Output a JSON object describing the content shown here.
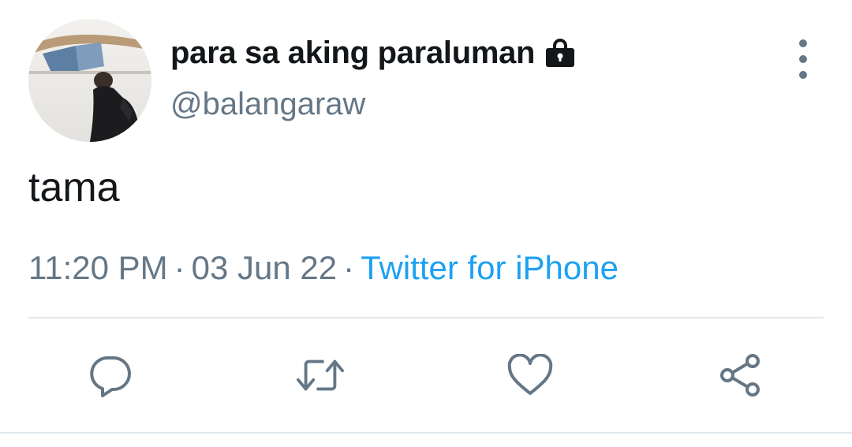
{
  "tweet": {
    "author": {
      "display_name": "para sa aking paraluman",
      "handle": "@balangaraw",
      "protected_icon": "lock-icon",
      "avatar_icon": "avatar"
    },
    "text": "tama",
    "meta": {
      "time": "11:20 PM",
      "separator": "·",
      "date": "03 Jun 22",
      "source": "Twitter for iPhone"
    },
    "actions": {
      "reply_icon": "reply-icon",
      "retweet_icon": "retweet-icon",
      "like_icon": "heart-icon",
      "share_icon": "share-icon"
    },
    "more_icon": "more-vertical-icon"
  },
  "colors": {
    "text_primary": "#14171a",
    "text_secondary": "#657786",
    "link": "#1da1f2",
    "divider": "#e1e8ed"
  }
}
